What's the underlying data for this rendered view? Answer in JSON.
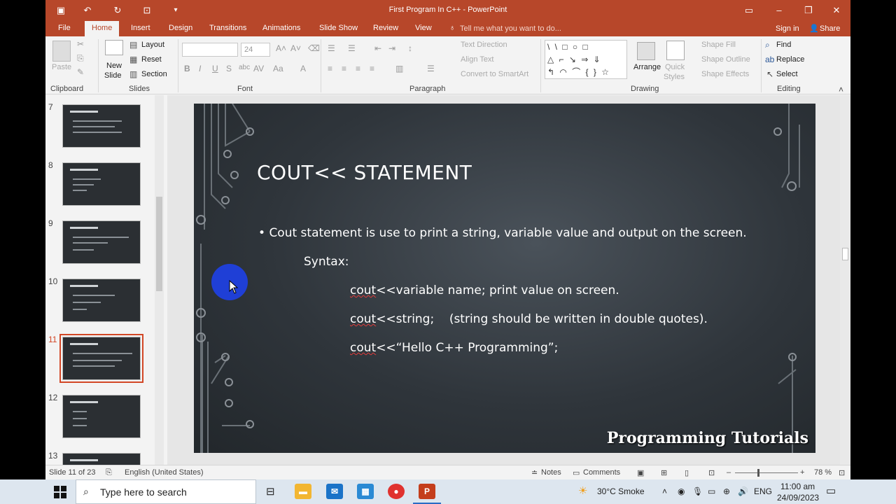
{
  "window": {
    "title": "First Program In C++  -  PowerPoint"
  },
  "menu": {
    "tabs": [
      "File",
      "Home",
      "Insert",
      "Design",
      "Transitions",
      "Animations",
      "Slide Show",
      "Review",
      "View"
    ],
    "tell_me": "Tell me what you want to do...",
    "sign_in": "Sign in",
    "share": "Share"
  },
  "ribbon": {
    "clipboard": {
      "label": "Clipboard",
      "paste": "Paste"
    },
    "slides": {
      "label": "Slides",
      "new_slide": "New",
      "new_slide2": "Slide",
      "layout": "Layout",
      "reset": "Reset",
      "section": "Section"
    },
    "font": {
      "label": "Font",
      "size": "24"
    },
    "paragraph": {
      "label": "Paragraph",
      "text_direction": "Text Direction",
      "align_text": "Align Text",
      "convert": "Convert to SmartArt"
    },
    "drawing": {
      "label": "Drawing",
      "arrange": "Arrange",
      "quick_styles": "Quick",
      "quick_styles2": "Styles",
      "shape_fill": "Shape Fill",
      "shape_outline": "Shape Outline",
      "shape_effects": "Shape Effects",
      "shape_glyphs": "\\ \\ □ ○ □\n△ ⌐ ↘ ⇒ ⇓\n↰ ◠ ⌒ { } ☆"
    },
    "editing": {
      "label": "Editing",
      "find": "Find",
      "replace": "Replace",
      "select": "Select"
    }
  },
  "thumbnails": [
    {
      "num": "7",
      "selected": false
    },
    {
      "num": "8",
      "selected": false
    },
    {
      "num": "9",
      "selected": false
    },
    {
      "num": "10",
      "selected": false
    },
    {
      "num": "11",
      "selected": true
    },
    {
      "num": "12",
      "selected": false
    },
    {
      "num": "13",
      "selected": false
    }
  ],
  "slide": {
    "title": "COUT<< STATEMENT",
    "bullet": "Cout statement is use to print a string, variable value and output on the screen.",
    "syntax": "Syntax:",
    "line1_kw": "cout",
    "line1_rest": "<<variable name; print value on screen.",
    "line2_kw": "cout",
    "line2_rest": "<<string;    (string should be written in double quotes).",
    "line3_kw": "cout",
    "line3_rest": "<<“Hello C++ Programming”;",
    "watermark": "Programming Tutorials"
  },
  "status": {
    "slide_info": "Slide 11 of 23",
    "language": "English (United States)",
    "notes": "Notes",
    "comments": "Comments",
    "zoom": "78 %"
  },
  "taskbar": {
    "search_placeholder": "Type here to search",
    "weather": "30°C  Smoke",
    "lang": "ENG",
    "time": "11:00 am",
    "date": "24/09/2023"
  }
}
